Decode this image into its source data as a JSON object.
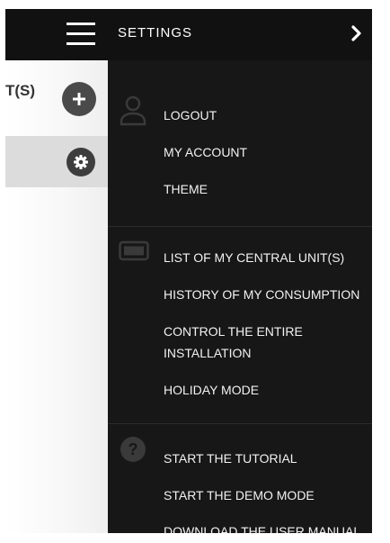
{
  "header": {
    "title": "SETTINGS",
    "menu_icon": "hamburger-icon",
    "chevron_icon": "chevron-right-icon"
  },
  "left_panel": {
    "title": "T(S)",
    "add_icon": "plus-icon",
    "settings_icon": "gear-icon"
  },
  "menu": {
    "account_section": {
      "icon": "user-icon",
      "items": [
        "LOGOUT",
        "MY ACCOUNT",
        "THEME"
      ]
    },
    "units_section": {
      "icon": "central-unit-icon",
      "items": [
        "LIST OF MY CENTRAL UNIT(S)",
        "HISTORY OF MY CONSUMPTION",
        "CONTROL THE ENTIRE",
        "INSTALLATION",
        "HOLIDAY MODE"
      ]
    },
    "help_section": {
      "icon": "help-icon",
      "items": [
        "START THE TUTORIAL",
        "START THE DEMO MODE",
        "DOWNLOAD THE USER MANUAL"
      ]
    }
  },
  "colors": {
    "topbar": "#111111",
    "drawer": "#171717",
    "text": "#f2f2f2",
    "icon": "#3a3a3a",
    "button": "#4a4a4a"
  }
}
